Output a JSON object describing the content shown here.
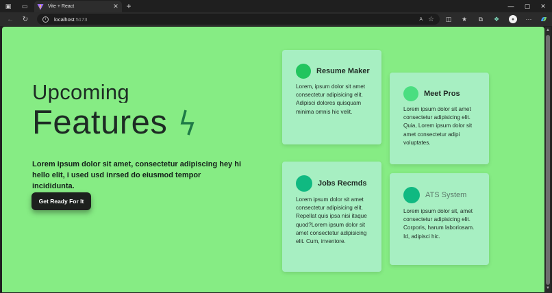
{
  "browser": {
    "tab_title": "Vite + React",
    "address_host": "localhost",
    "address_port": ":5173",
    "read_aloud_label": "A",
    "profile_initial": "●"
  },
  "icons": {
    "workspaces": "▣",
    "tab_actions": "▭",
    "close_tab": "✕",
    "new_tab": "+",
    "back": "←",
    "refresh": "↻",
    "info": "i",
    "favorite_star": "☆",
    "split_screen": "◫",
    "favorites": "★",
    "collections": "⧉",
    "extensions": "❖",
    "more": "···",
    "minimize": "—",
    "maximize": "▢",
    "close_window": "✕",
    "bolt": "bolt-icon"
  },
  "hero": {
    "title_line1": "Upcoming",
    "title_line2": "Features",
    "description": "Lorem ipsum dolor sit amet, consectetur adipiscing hey hi hello elit, i used usd inrsed do eiusmod tempor incididunta.",
    "cta_label": "Get Ready For It"
  },
  "cards": [
    {
      "title": "Resume Maker",
      "body": "Lorem, ipsum dolor sit amet consectetur adipisicing elit. Adipisci dolores quisquam minima omnis hic velit.",
      "dot_color": "#22c55e"
    },
    {
      "title": "Meet Pros",
      "body": "Lorem ipsum dolor sit amet consectetur adipisicing elit. Quia, Lorem ipsum dolor sit amet consectetur adipi voluptates.",
      "dot_color": "#4ade80"
    },
    {
      "title": "Jobs Recmds",
      "body": "Lorem ipsum dolor sit amet consectetur adipisicing elit. Repellat quis ipsa nisi itaque quod?Lorem ipsum dolor sit amet consectetur adipisicing elit. Cum, inventore.",
      "dot_color": "#10b981"
    },
    {
      "title": "ATS System",
      "body": "Lorem ipsum dolor sit, amet consectetur adipisicing elit. Corporis, harum laboriosam. Id, adipisci hic.",
      "dot_color": "#10b981"
    }
  ],
  "colors": {
    "page_bg": "#86ec84",
    "card_bg": "#a7efc2",
    "heading": "#1d2b24",
    "cta_bg": "#1d201e"
  }
}
